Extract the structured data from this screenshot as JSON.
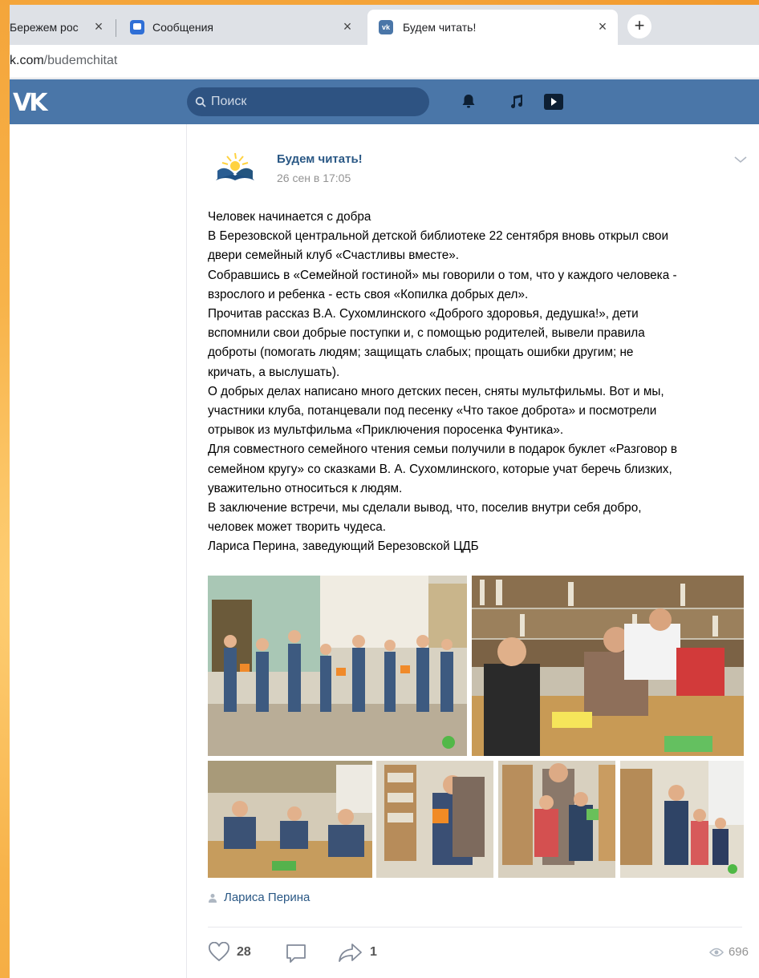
{
  "browser": {
    "tabs": [
      {
        "label": "Бережем рос"
      },
      {
        "label": "Сообщения"
      },
      {
        "label": "Будем читать!"
      }
    ],
    "tab_close": "×",
    "new_tab": "+",
    "url_host": "k.com",
    "url_path": "/budemchitat"
  },
  "header": {
    "logo": "VK",
    "search_placeholder": "Поиск"
  },
  "post": {
    "group_name": "Будем читать!",
    "date": "26 сен в 17:05",
    "text_lines": [
      "Человек начинается с добра",
      "В Березовской центральной детской библиотеке 22 сентября вновь открыл свои",
      "двери семейный клуб «Счастливы вместе».",
      "Собравшись в «Семейной гостиной» мы говорили о том, что у каждого человека -",
      "взрослого и ребенка - есть своя «Копилка добрых дел».",
      "Прочитав рассказ В.А. Сухомлинского «Доброго здоровья, дедушка!», дети",
      "вспомнили свои добрые поступки и, с помощью родителей, вывели правила",
      "доброты (помогать людям; защищать слабых; прощать ошибки другим; не",
      "кричать, а выслушать).",
      "О добрых делах написано много детских песен, сняты мультфильмы. Вот и мы,",
      "участники клуба, потанцевали под песенку «Что такое доброта» и посмотрели",
      "отрывок из мультфильма «Приключения поросенка Фунтика».",
      "Для совместного семейного чтения семьи получили в подарок буклет «Разговор в",
      "семейном кругу» со сказками В. А. Сухомлинского, которые учат беречь близких,",
      "уважительно относиться к людям.",
      "В заключение встречи, мы сделали вывод, что, поселив внутри себя добро,",
      "человек может творить чудеса.",
      "Лариса Перина, заведующий Березовской ЦДБ"
    ],
    "author": "Лариса Перина",
    "likes": "28",
    "shares": "1",
    "views": "696"
  },
  "colors": {
    "vk_blue": "#4a76a8",
    "search_bg": "#2e5382",
    "link": "#2a5885"
  }
}
